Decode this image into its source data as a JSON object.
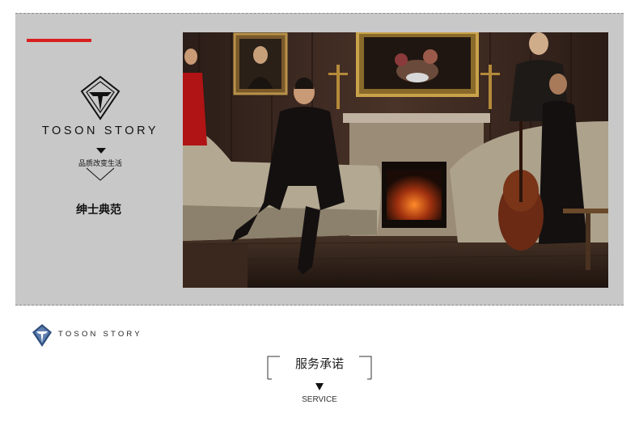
{
  "banner": {
    "brand_name": "TOSON STORY",
    "slogan": "品质改变生活",
    "tagline": "绅士典范",
    "accent_color": "#d81e1e",
    "logo_icon": "diamond-t-logo-icon",
    "photo": "gentleman-lounge-photo"
  },
  "footer": {
    "brand_name": "TOSON STORY",
    "logo_icon": "shield-t-logo-icon"
  },
  "service": {
    "title": "服务承诺",
    "subtitle": "SERVICE",
    "marker_icon": "triangle-down-icon"
  }
}
